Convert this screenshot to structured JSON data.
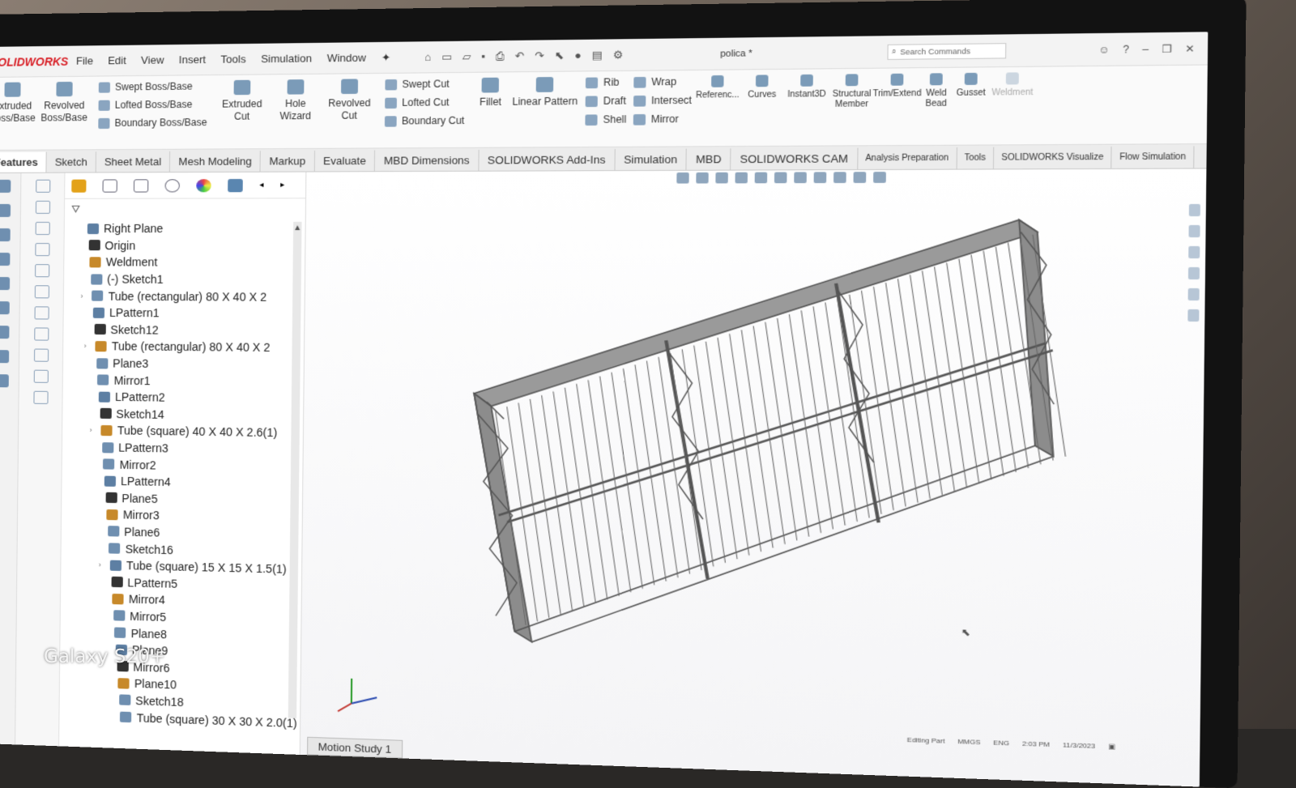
{
  "app": {
    "logo": "SOLIDWORKS",
    "doc_title": "polica *",
    "search_placeholder": "Search Commands"
  },
  "menu": [
    "File",
    "Edit",
    "View",
    "Insert",
    "Tools",
    "Simulation",
    "Window"
  ],
  "ribbon": {
    "extruded_boss": "Extruded Boss/Base",
    "revolved_boss": "Revolved Boss/Base",
    "swept_boss": "Swept Boss/Base",
    "lofted_boss": "Lofted Boss/Base",
    "boundary_boss": "Boundary Boss/Base",
    "extruded_cut": "Extruded Cut",
    "hole_wizard": "Hole Wizard",
    "revolved_cut": "Revolved Cut",
    "swept_cut": "Swept Cut",
    "lofted_cut": "Lofted Cut",
    "boundary_cut": "Boundary Cut",
    "fillet": "Fillet",
    "linear_pattern": "Linear Pattern",
    "rib": "Rib",
    "draft": "Draft",
    "shell": "Shell",
    "wrap": "Wrap",
    "intersect": "Intersect",
    "mirror": "Mirror",
    "reference": "Referenc...",
    "curves": "Curves",
    "instant3d": "Instant3D",
    "structural_member": "Structural Member",
    "trim_extend": "Trim/Extend",
    "weld_bead": "Weld Bead",
    "gusset": "Gusset",
    "weldment": "Weldment"
  },
  "tabs": [
    "Features",
    "Sketch",
    "Sheet Metal",
    "Mesh Modeling",
    "Markup",
    "Evaluate",
    "MBD Dimensions",
    "SOLIDWORKS Add-Ins",
    "Simulation",
    "MBD",
    "SOLIDWORKS CAM",
    "Analysis Preparation",
    "Tools",
    "SOLIDWORKS Visualize",
    "Flow Simulation"
  ],
  "tree": [
    {
      "label": "Right Plane"
    },
    {
      "label": "Origin"
    },
    {
      "label": "Weldment"
    },
    {
      "label": "(-) Sketch1"
    },
    {
      "label": "Tube (rectangular) 80 X 40 X 2",
      "exp": "›"
    },
    {
      "label": "LPattern1"
    },
    {
      "label": "Sketch12"
    },
    {
      "label": "Tube (rectangular) 80 X 40 X 2",
      "exp": "›"
    },
    {
      "label": "Plane3"
    },
    {
      "label": "Mirror1"
    },
    {
      "label": "LPattern2"
    },
    {
      "label": "Sketch14"
    },
    {
      "label": "Tube (square) 40 X 40 X 2.6(1)",
      "exp": "›"
    },
    {
      "label": "LPattern3"
    },
    {
      "label": "Mirror2"
    },
    {
      "label": "LPattern4"
    },
    {
      "label": "Plane5"
    },
    {
      "label": "Mirror3"
    },
    {
      "label": "Plane6"
    },
    {
      "label": "Sketch16"
    },
    {
      "label": "Tube (square) 15 X 15 X 1.5(1)",
      "exp": "›"
    },
    {
      "label": "LPattern5"
    },
    {
      "label": "Mirror4"
    },
    {
      "label": "Mirror5"
    },
    {
      "label": "Plane8"
    },
    {
      "label": "Plane9"
    },
    {
      "label": "Mirror6"
    },
    {
      "label": "Plane10"
    },
    {
      "label": "Sketch18"
    },
    {
      "label": "Tube (square) 30 X 30 X 2.0(1)"
    }
  ],
  "bottom_tab": "Motion Study 1",
  "status": {
    "editing": "Editing Part",
    "units": "MMGS",
    "lang": "ENG",
    "time": "2:03 PM",
    "date": "11/3/2023"
  },
  "watermark": "Galaxy S20+",
  "colors": {
    "accent_red": "#d81f26",
    "frame_gray": "#5a5a5a",
    "viewport_bg": "#ffffff"
  }
}
